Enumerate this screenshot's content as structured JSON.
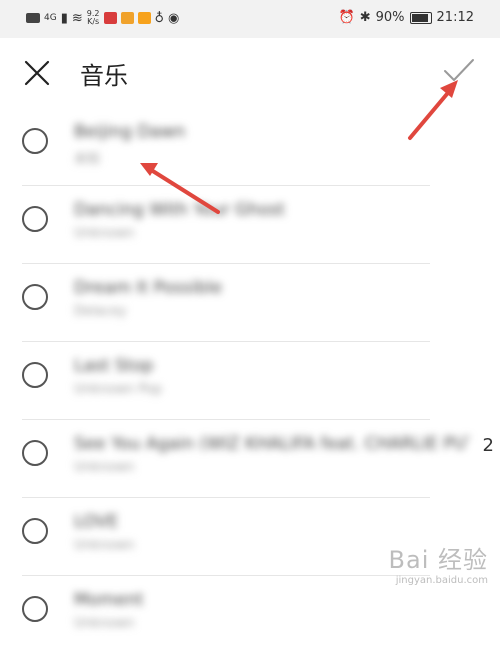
{
  "status_bar": {
    "network": "4G",
    "speed_value": "9.2",
    "speed_unit": "K/s",
    "battery": "90%",
    "time": "21:12"
  },
  "header": {
    "title": "音乐"
  },
  "songs": [
    {
      "title": "Beijing Dawn",
      "artist": "未知"
    },
    {
      "title": "Dancing With Your Ghost",
      "artist": "Unknown"
    },
    {
      "title": "Dream It Possible",
      "artist": "Delacey"
    },
    {
      "title": "Last Stop",
      "artist": "Unknown Pop"
    },
    {
      "title": "See You Again (WIZ KHALIFA feat. CHARLIE PUTH)",
      "artist": "Unknown"
    },
    {
      "title": "LOVE",
      "artist": "Unknown"
    },
    {
      "title": "Moment",
      "artist": "Unknown"
    }
  ],
  "overflow_char": "2",
  "watermark": {
    "brand": "Bai 经验",
    "url": "jingyan.baidu.com"
  },
  "colors": {
    "accent_arrow": "#e0473e",
    "status_bg": "#f2f2f2"
  }
}
